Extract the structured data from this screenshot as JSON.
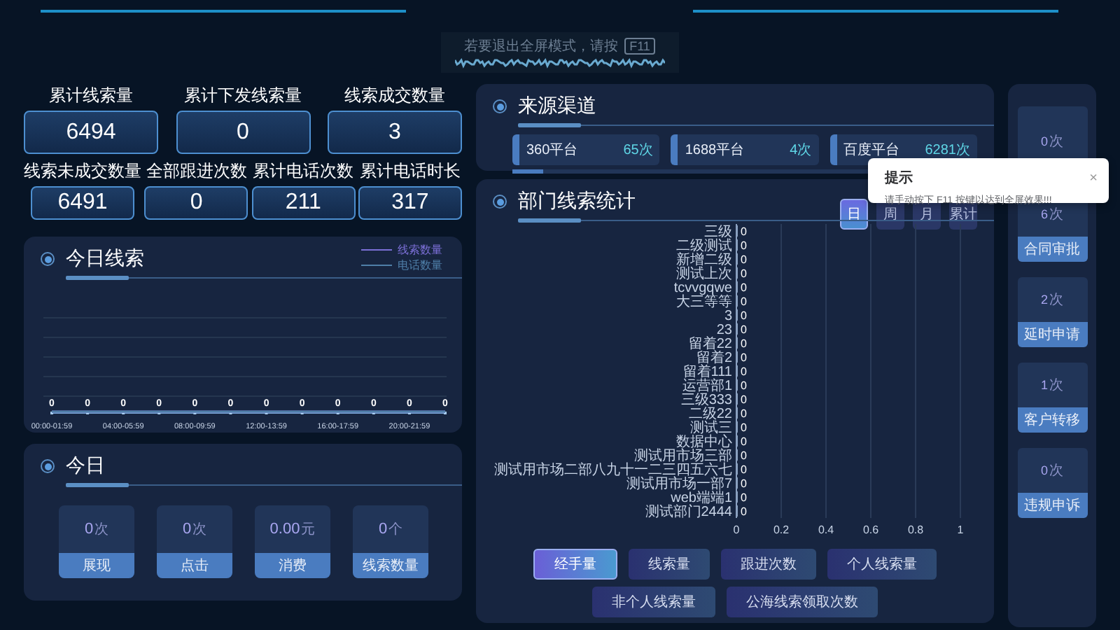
{
  "banner": {
    "text": "若要退出全屏模式，请按",
    "key": "F11"
  },
  "stats": [
    {
      "label": "累计线索量",
      "value": "6494"
    },
    {
      "label": "累计下发线索量",
      "value": "0"
    },
    {
      "label": "线索成交数量",
      "value": "3"
    },
    {
      "label": "线索未成交数量",
      "value": "6491"
    },
    {
      "label": "全部跟进次数",
      "value": "0"
    },
    {
      "label": "累计电话次数",
      "value": "211"
    },
    {
      "label": "累计电话时长",
      "value": "317"
    }
  ],
  "today_leads": {
    "title": "今日线索",
    "legend": [
      {
        "name": "线索数量",
        "color": "#7b6fd6"
      },
      {
        "name": "电话数量",
        "color": "#4f7fa8"
      }
    ],
    "point_labels": [
      "0",
      "0",
      "0",
      "0",
      "0",
      "0",
      "0",
      "0",
      "0",
      "0",
      "0",
      "0"
    ],
    "time_labels": [
      "00:00-01:59",
      "04:00-05:59",
      "08:00-09:59",
      "12:00-13:59",
      "16:00-17:59",
      "20:00-21:59"
    ]
  },
  "today": {
    "title": "今日",
    "cards": [
      {
        "value": "0",
        "unit": "次",
        "label": "展现"
      },
      {
        "value": "0",
        "unit": "次",
        "label": "点击"
      },
      {
        "value": "0.00",
        "unit": "元",
        "label": "消费"
      },
      {
        "value": "0",
        "unit": "个",
        "label": "线索数量"
      }
    ]
  },
  "sources": {
    "title": "来源渠道",
    "items": [
      {
        "name": "360平台",
        "count": "65次"
      },
      {
        "name": "1688平台",
        "count": "4次"
      },
      {
        "name": "百度平台",
        "count": "6281次"
      }
    ]
  },
  "department": {
    "title": "部门线索统计",
    "periods": [
      {
        "label": "日",
        "selected": true
      },
      {
        "label": "周",
        "selected": false
      },
      {
        "label": "月",
        "selected": false
      },
      {
        "label": "累计",
        "selected": false
      }
    ],
    "chart_data": {
      "type": "bar",
      "orientation": "horizontal",
      "categories": [
        "三级",
        "二级测试",
        "新增二级",
        "测试上次",
        "tcvvgqwe",
        "大三等等",
        "3",
        "23",
        "留着22",
        "留着2",
        "留着111",
        "运营部1",
        "三级333",
        "二级22",
        "测试三",
        "数据中心",
        "测试用市场三部",
        "测试用市场二部八九十一二三四五六七",
        "测试用市场一部7",
        "web端端1",
        "测试部门2444"
      ],
      "values": [
        0,
        0,
        0,
        0,
        0,
        0,
        0,
        0,
        0,
        0,
        0,
        0,
        0,
        0,
        0,
        0,
        0,
        0,
        0,
        0,
        0
      ],
      "xlim": [
        0,
        1
      ],
      "xticks": [
        0,
        0.2,
        0.4,
        0.6,
        0.8,
        1
      ],
      "grid": true,
      "value_labels": [
        "0",
        "0",
        "0",
        "0",
        "0",
        "0",
        "0",
        "0",
        "0",
        "0",
        "0",
        "0",
        "0",
        "0",
        "0",
        "0",
        "0",
        "0",
        "0",
        "0",
        "0"
      ]
    },
    "metrics": [
      {
        "label": "经手量",
        "selected": true
      },
      {
        "label": "线索量",
        "selected": false
      },
      {
        "label": "跟进次数",
        "selected": false
      },
      {
        "label": "个人线索量",
        "selected": false
      },
      {
        "label": "非个人线索量",
        "selected": false
      },
      {
        "label": "公海线索领取次数",
        "selected": false
      }
    ]
  },
  "approvals": [
    {
      "value": "0",
      "unit": "次"
    },
    {
      "value": "6",
      "unit": "次",
      "label": "合同审批"
    },
    {
      "value": "2",
      "unit": "次",
      "label": "延时申请"
    },
    {
      "value": "1",
      "unit": "次",
      "label": "客户转移"
    },
    {
      "value": "0",
      "unit": "次",
      "label": "违规申诉"
    }
  ],
  "toast": {
    "title": "提示",
    "message": "请手动按下 F11 按键以达到全屏效果!!!",
    "close": "×"
  }
}
